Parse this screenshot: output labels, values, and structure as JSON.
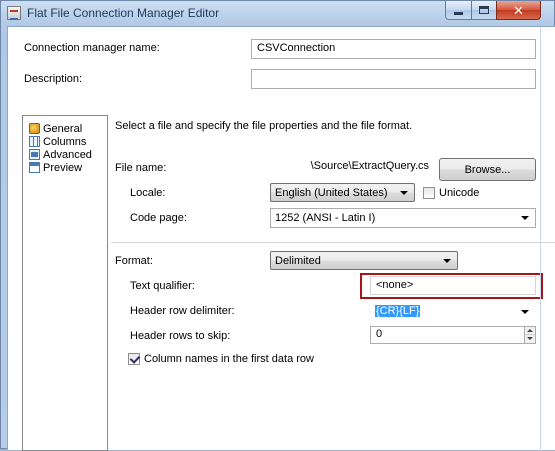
{
  "window": {
    "title": "Flat File Connection Manager Editor"
  },
  "header": {
    "conn_name_label": "Connection manager name:",
    "conn_name_value": "CSVConnection",
    "description_label": "Description:",
    "description_value": ""
  },
  "nav": {
    "items": [
      {
        "label": "General",
        "icon": "general-icon",
        "selected": true
      },
      {
        "label": "Columns",
        "icon": "columns-icon"
      },
      {
        "label": "Advanced",
        "icon": "advanced-icon"
      },
      {
        "label": "Preview",
        "icon": "preview-icon"
      }
    ]
  },
  "general": {
    "instruction": "Select a file and specify the file properties and the file format.",
    "file_name_label": "File name:",
    "file_name_value": "\\Source\\ExtractQuery.cs",
    "browse_label": "Browse...",
    "locale_label": "Locale:",
    "locale_value": "English (United States)",
    "unicode_label": "Unicode",
    "unicode_checked": false,
    "code_page_label": "Code page:",
    "code_page_value": "1252  (ANSI - Latin I)",
    "format_label": "Format:",
    "format_value": "Delimited",
    "text_qualifier_label": "Text qualifier:",
    "text_qualifier_value": "<none>",
    "header_row_delim_label": "Header row delimiter:",
    "header_row_delim_value": "{CR}{LF}",
    "header_rows_skip_label": "Header rows to skip:",
    "header_rows_skip_value": "0",
    "col_names_label": "Column names in the first data row",
    "col_names_checked": true
  },
  "colors": {
    "highlight_border": "#a4161a",
    "selection": "#3399ff",
    "window_frame": "#b7cde6"
  }
}
